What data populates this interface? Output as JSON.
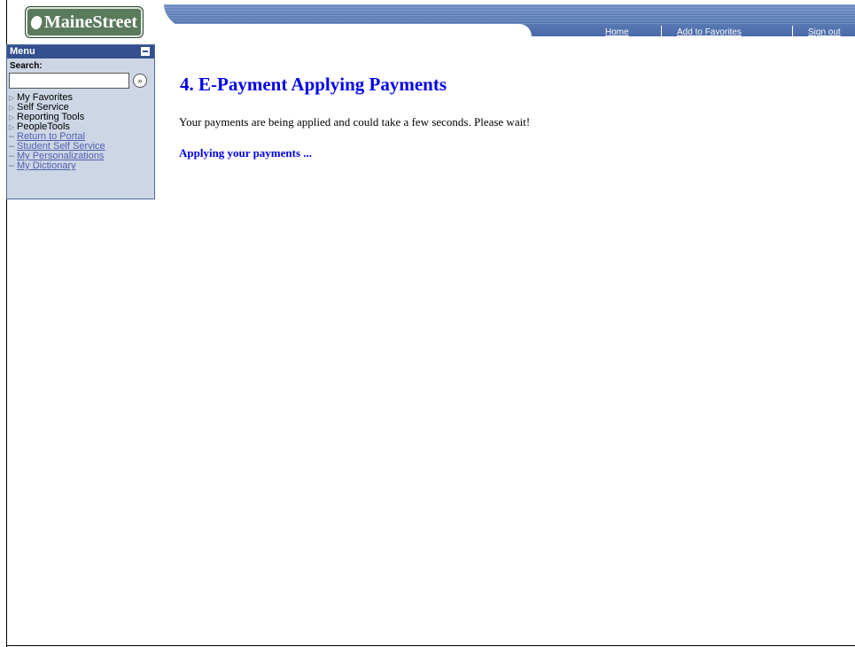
{
  "logo": {
    "text": "MaineStreet"
  },
  "header": {
    "nav": [
      {
        "label": "Home"
      },
      {
        "label": "Add to Favorites"
      },
      {
        "label": "Sign out"
      }
    ]
  },
  "menu": {
    "title": "Menu",
    "search_label": "Search:",
    "search_value": "",
    "search_go_glyph": "»",
    "items": [
      {
        "label": "My Favorites",
        "kind": "folder"
      },
      {
        "label": "Self Service",
        "kind": "folder"
      },
      {
        "label": "Reporting Tools",
        "kind": "folder"
      },
      {
        "label": "PeopleTools",
        "kind": "folder"
      },
      {
        "label": "Return to Portal",
        "kind": "link"
      },
      {
        "label": "Student Self Service",
        "kind": "link"
      },
      {
        "label": "My Personalizations",
        "kind": "link"
      },
      {
        "label": "My Dictionary",
        "kind": "link"
      }
    ]
  },
  "main": {
    "title": "4. E-Payment Applying Payments",
    "message": "Your payments are being applied and could take a few seconds. Please wait!",
    "status": "Applying your payments ..."
  },
  "colors": {
    "title_blue": "#0000ee",
    "menu_header": "#34508f",
    "menu_bg": "#cdd6e5"
  }
}
